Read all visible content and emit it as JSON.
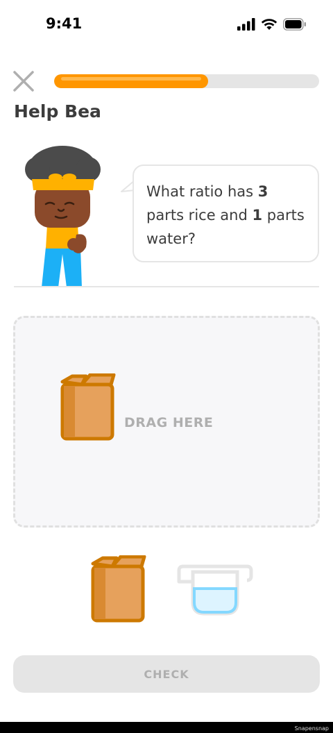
{
  "status_bar": {
    "time": "9:41",
    "icons": [
      "signal-icon",
      "wifi-icon",
      "battery-icon"
    ]
  },
  "header": {
    "close_icon": "close-icon",
    "progress_fraction": 0.58,
    "progress_color": "#ff9600"
  },
  "title": "Help Bea",
  "character": {
    "name": "Bea"
  },
  "bubble": {
    "part1": "What ratio has ",
    "num1": "3",
    "part2": " parts rice and ",
    "num2": "1",
    "part3": " parts water?"
  },
  "drop_zone": {
    "label": "DRAG HERE",
    "icon": "rice-box-icon"
  },
  "tiles": [
    {
      "name": "rice-box-tile",
      "icon": "rice-box-icon"
    },
    {
      "name": "water-cup-tile",
      "icon": "water-cup-icon"
    }
  ],
  "check_button": {
    "label": "CHECK"
  },
  "watermark": "Snapensnap"
}
